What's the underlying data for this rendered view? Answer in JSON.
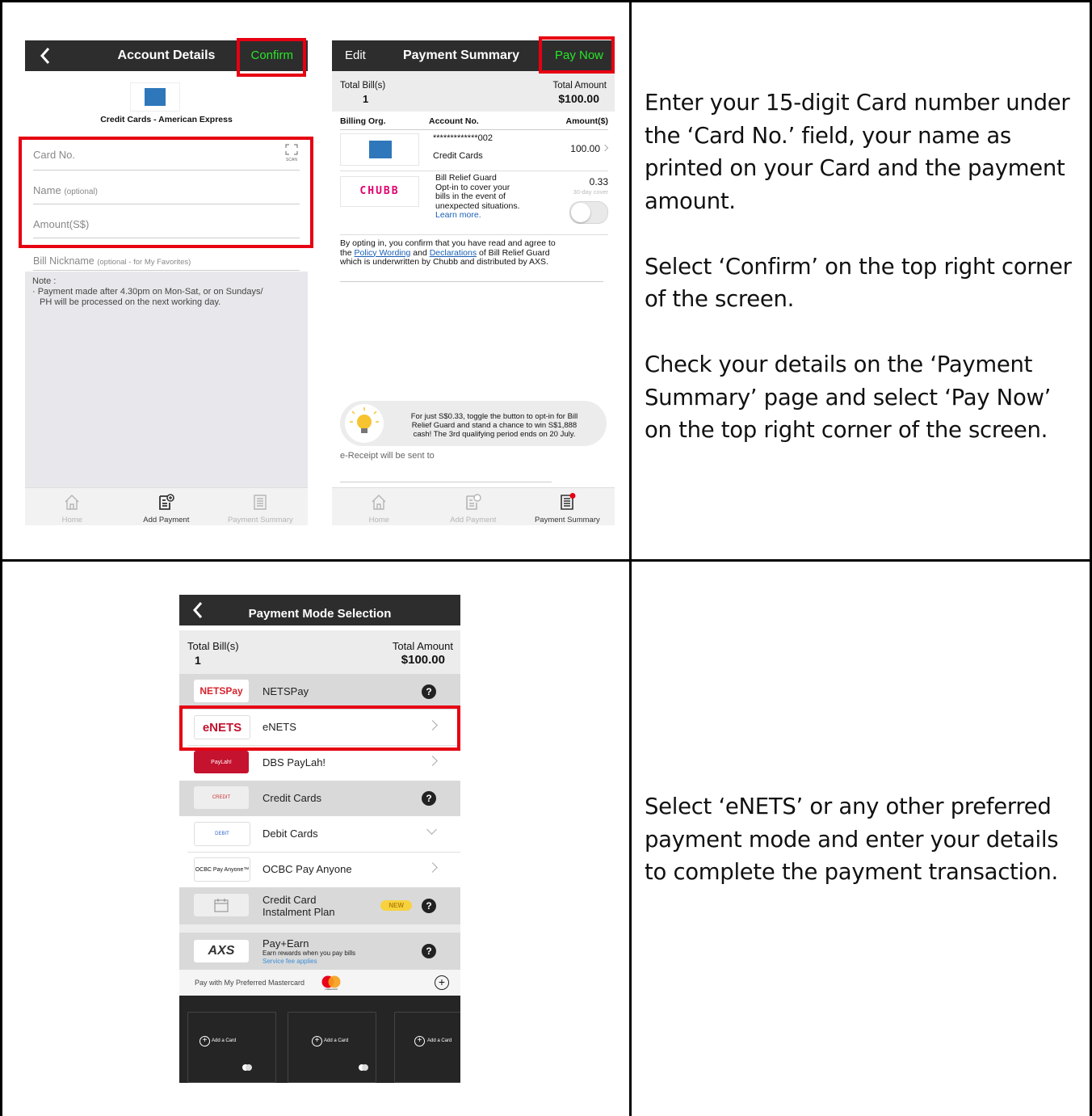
{
  "row1": {
    "instructions": [
      "Enter your 15-digit Card number under the ‘Card No.’ field, your name as printed on your Card and the payment amount.",
      "Select ‘Confirm’ on the top right corner of the screen.",
      "Check your details on the ‘Payment Summary’ page and select ‘Pay Now’ on the top right corner of the screen."
    ]
  },
  "row2": {
    "instructions": [
      "Select ‘eNETS’ or any other preferred payment mode and enter your details to complete the payment transaction."
    ]
  },
  "account_details": {
    "title": "Account Details",
    "confirm_label": "Confirm",
    "org_name": "Credit Cards - American Express",
    "card_no_placeholder": "Card No.",
    "scan_label": "SCAN",
    "name_placeholder": "Name",
    "name_optional": "(optional)",
    "amount_placeholder": "Amount(S$)",
    "nickname_placeholder": "Bill Nickname",
    "nickname_hint": "(optional - for My Favorites)",
    "note_title": "Note :",
    "note_line1": "· Payment made after 4.30pm on Mon-Sat, or on Sundays/",
    "note_line2": "PH will be processed on the next working day."
  },
  "payment_summary": {
    "edit_label": "Edit",
    "title": "Payment Summary",
    "pay_now_label": "Pay Now",
    "total_bills_label": "Total Bill(s)",
    "total_bills_value": "1",
    "total_amount_label": "Total Amount",
    "total_amount_value": "$100.00",
    "col_billing_org": "Billing Org.",
    "col_account_no": "Account No.",
    "col_amount": "Amount($)",
    "bill_account_no": "*************002",
    "bill_account_type": "Credit Cards",
    "bill_amount": "100.00",
    "chubb_logo_text": "CHUBB",
    "relief_title": "Bill Relief Guard",
    "relief_desc1": "Opt-in to cover your",
    "relief_desc2": "bills in the event of",
    "relief_desc3": "unexpected situations.",
    "learn_more": "Learn more.",
    "relief_amount": "0.33",
    "relief_cover": "30-day cover",
    "optin_text1": "By opting in, you confirm that you have read and agree to",
    "optin_the": "the ",
    "optin_policy": "Policy Wording",
    "optin_and": " and ",
    "optin_decl": "Declarations",
    "optin_text2": " of Bill Relief Guard",
    "optin_text3": "which is underwritten by Chubb and distributed by AXS.",
    "promo1": "For just S$0.33, toggle the button to opt-in for Bill",
    "promo2": "Relief Guard and stand a chance to win S$1,888",
    "promo3": "cash! The 3rd qualifying period ends on 20 July.",
    "ereceipt": "e-Receipt will be sent to"
  },
  "tabs": {
    "home": "Home",
    "add_payment": "Add Payment",
    "payment_summary": "Payment Summary"
  },
  "payment_mode": {
    "title": "Payment Mode Selection",
    "total_bills_label": "Total Bill(s)",
    "total_bills_value": "1",
    "total_amount_label": "Total Amount",
    "total_amount_value": "$100.00",
    "options": {
      "netspay": "NETSPay",
      "enets": "eNETS",
      "paylah": "DBS PayLah!",
      "credit": "Credit Cards",
      "debit": "Debit Cards",
      "ocbc": "OCBC Pay Anyone",
      "instalment1": "Credit Card",
      "instalment2": "Instalment Plan",
      "payearn": "Pay+Earn",
      "payearn_sub": "Earn rewards when you pay bills",
      "payearn_fee": "Service fee applies"
    },
    "logos": {
      "netspay": "NETSPay",
      "enets": "eNETS",
      "paylah": "PayLah!",
      "ocbc": "OCBC Pay Anyone™",
      "axs": "AXS",
      "credit": "CREDIT",
      "debit": "DEBIT"
    },
    "new_badge": "NEW",
    "mastercard_label": "Pay with My Preferred Mastercard",
    "mastercard_small": "mastercard",
    "add_card": "Add a Card"
  },
  "colors": {
    "highlight": "#e60012",
    "header": "#2d2d2d",
    "green": "#29e629",
    "link": "#1a5fb4"
  }
}
